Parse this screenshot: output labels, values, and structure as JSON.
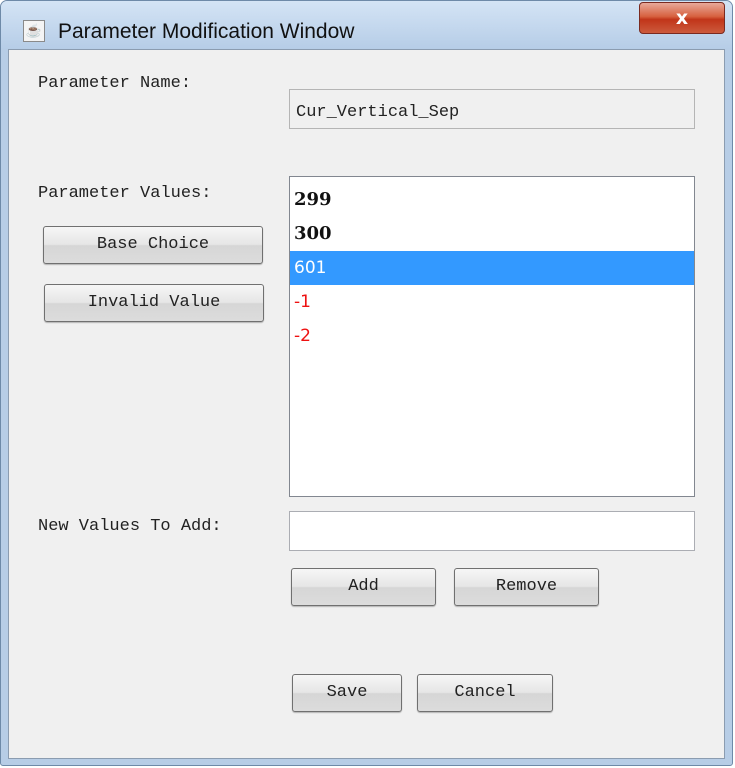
{
  "window": {
    "title": "Parameter Modification Window",
    "app_icon": "java-cup-icon",
    "close_label": "x"
  },
  "form": {
    "parameter_name_label": "Parameter Name:",
    "parameter_name_value": "Cur_Vertical_Sep",
    "parameter_values_label": "Parameter Values:",
    "base_choice_label": "Base Choice",
    "invalid_value_label": "Invalid Value",
    "values": [
      {
        "text": "299",
        "style": "base-choice"
      },
      {
        "text": "300",
        "style": "base-choice"
      },
      {
        "text": "601",
        "style": "selected"
      },
      {
        "text": "-1",
        "style": "invalid"
      },
      {
        "text": "-2",
        "style": "invalid"
      }
    ],
    "new_values_label": "New Values To Add:",
    "new_values_value": "",
    "add_label": "Add",
    "remove_label": "Remove",
    "save_label": "Save",
    "cancel_label": "Cancel"
  },
  "colors": {
    "selection": "#3399ff",
    "invalid_text": "#ee1111",
    "close_button": "#c13519",
    "titlebar": "#b6cde7"
  }
}
